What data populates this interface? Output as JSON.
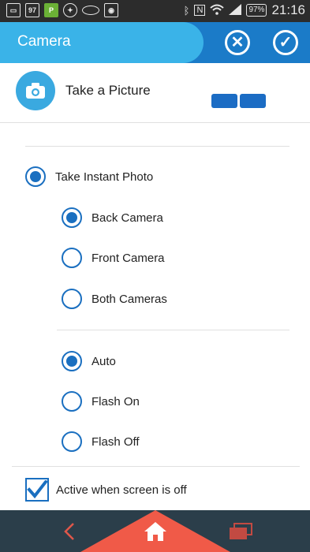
{
  "status_bar": {
    "notif_icons": [
      "image-icon",
      "calendar-icon",
      "app-icon",
      "accessibility-icon",
      "oval-icon",
      "camera-icon"
    ],
    "calendar_day": "97",
    "battery": "97%",
    "time": "21:16"
  },
  "app_bar": {
    "title": "Camera",
    "cancel_icon": "close-circle-icon",
    "confirm_icon": "check-circle-icon"
  },
  "header": {
    "title": "Take a Picture",
    "icon": "camera-icon"
  },
  "mode": {
    "label": "Take Instant Photo",
    "selected": true
  },
  "camera_options": [
    {
      "label": "Back Camera",
      "selected": true
    },
    {
      "label": "Front Camera",
      "selected": false
    },
    {
      "label": "Both Cameras",
      "selected": false
    }
  ],
  "flash_options": [
    {
      "label": "Auto",
      "selected": true
    },
    {
      "label": "Flash On",
      "selected": false
    },
    {
      "label": "Flash Off",
      "selected": false
    }
  ],
  "screen_off": {
    "label": "Active when screen is off",
    "checked": true
  },
  "colors": {
    "app_bar": "#1b7bc8",
    "title_tab": "#3ab3e8",
    "accent": "#1a6fc0",
    "nav_bar": "#2b3e4a",
    "home_highlight": "#f05a48"
  }
}
